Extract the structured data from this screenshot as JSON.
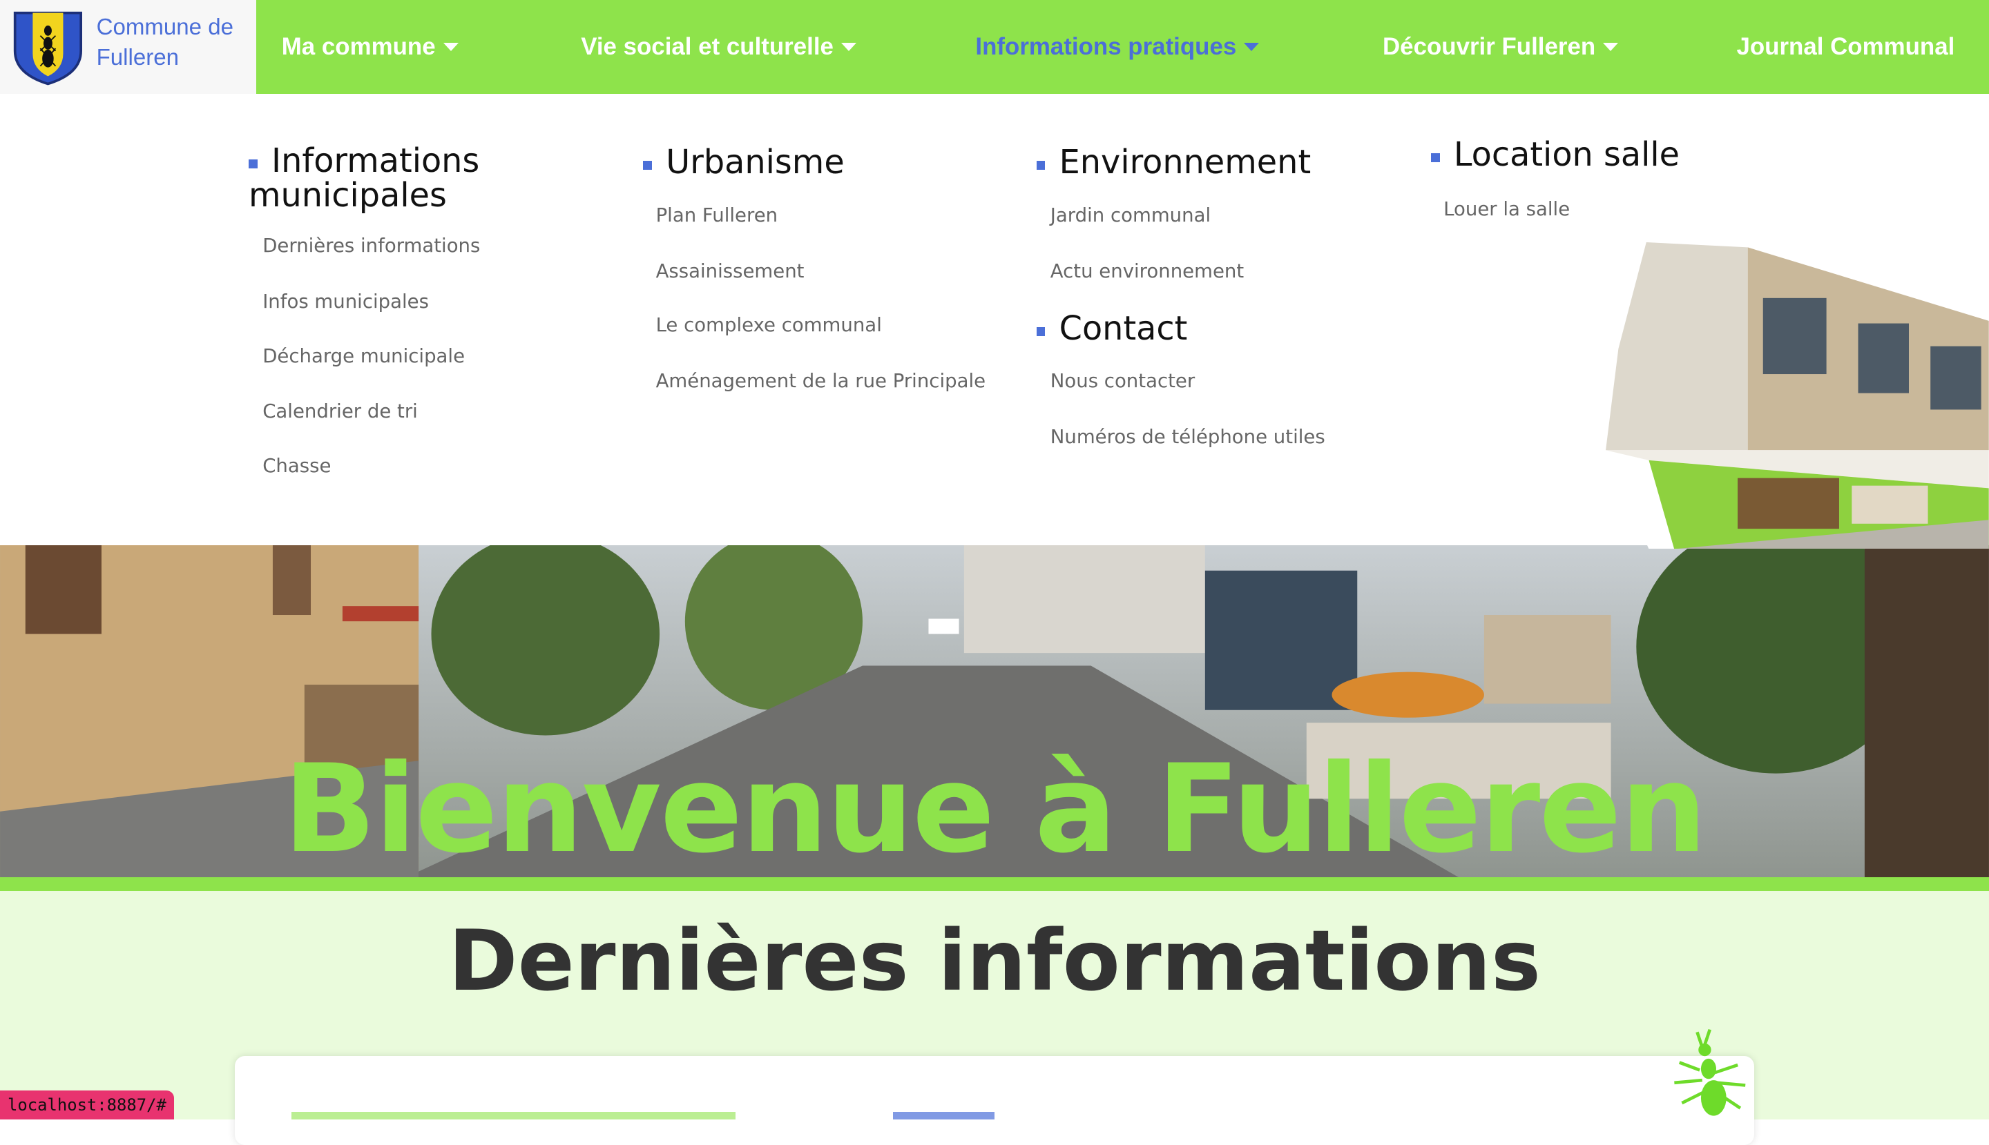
{
  "brand": {
    "name_line1": "Commune de",
    "name_line2": "Fulleren",
    "crest": "commune-crest"
  },
  "nav": [
    {
      "label": "Ma commune",
      "has_dropdown": true
    },
    {
      "label": "Vie social et culturelle",
      "has_dropdown": true
    },
    {
      "label": "Informations pratiques",
      "has_dropdown": true,
      "active": true
    },
    {
      "label": "Découvrir Fulleren",
      "has_dropdown": true
    },
    {
      "label": "Journal Communal",
      "has_dropdown": false
    }
  ],
  "menu": {
    "col1": {
      "title_line1": "Informations",
      "title_line2": "municipales",
      "links": [
        "Dernières informations",
        "Infos municipales",
        "Décharge municipale",
        "Calendrier de tri",
        "Chasse"
      ]
    },
    "col2": {
      "title": "Urbanisme",
      "links": [
        "Plan Fulleren",
        "Assainissement",
        "Le complexe communal",
        "Aménagement de la rue Principale"
      ]
    },
    "col3": {
      "title": "Environnement",
      "links": [
        "Jardin communal",
        "Actu environnement"
      ]
    },
    "col3b": {
      "title": "Contact",
      "links": [
        "Nous contacter",
        "Numéros de téléphone utiles"
      ]
    },
    "col4": {
      "title": "Location salle",
      "links": [
        "Louer la salle"
      ]
    }
  },
  "hero": {
    "title": "Bienvenue à Fulleren"
  },
  "news": {
    "title": "Dernières informations"
  },
  "status_bar": "localhost:8887/#",
  "colors": {
    "accent_green": "#8ee34b",
    "link_blue": "#4b6fd8",
    "news_bg": "#eafbdc"
  }
}
